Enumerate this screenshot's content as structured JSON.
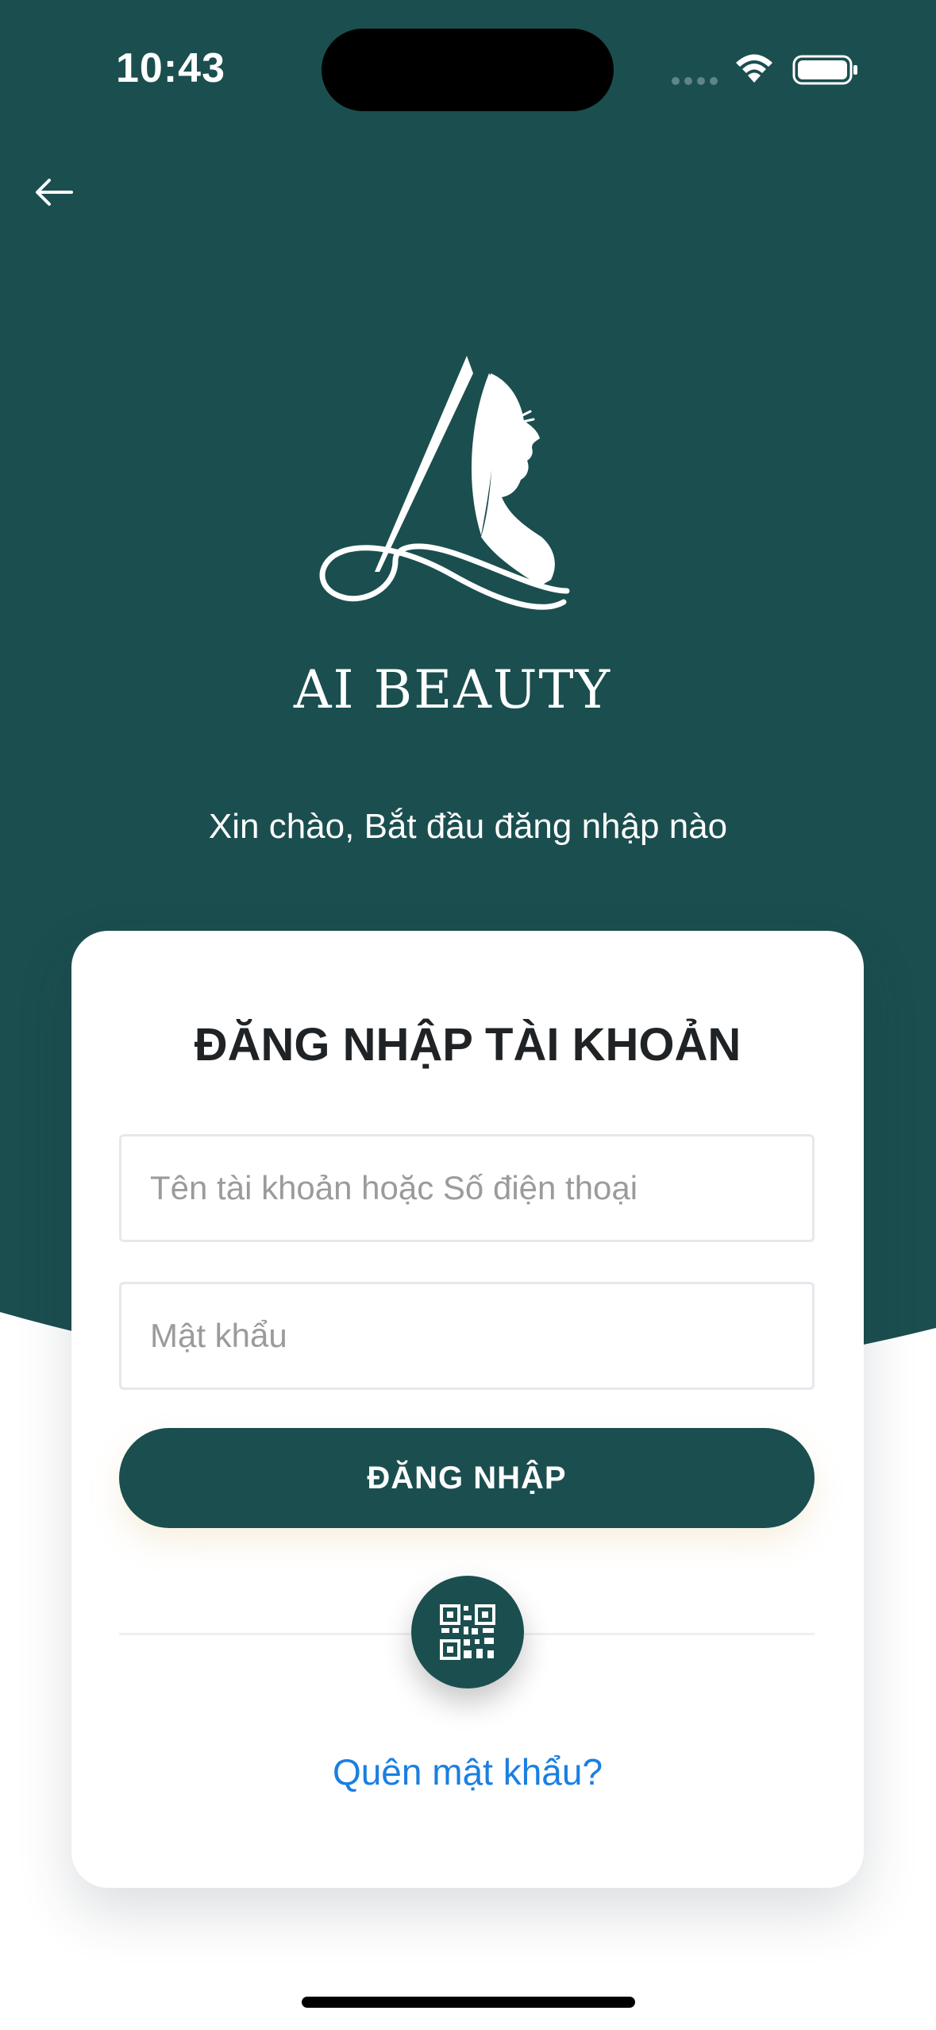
{
  "status_bar": {
    "time": "10:43"
  },
  "header": {
    "back_icon": "arrow-left-icon"
  },
  "brand": {
    "logo_icon": "woman-profile-logo",
    "name": "AI BEAUTY"
  },
  "greeting": "Xin chào, Bắt đầu đăng nhập nào",
  "login_card": {
    "title": "ĐĂNG NHẬP TÀI KHOẢN",
    "username": {
      "value": "",
      "placeholder": "Tên tài khoản hoặc Số điện thoại"
    },
    "password": {
      "value": "",
      "placeholder": "Mật khẩu"
    },
    "login_button_label": "ĐĂNG NHẬP",
    "qr_icon": "qr-code-icon",
    "forgot_password_label": "Quên mật khẩu?"
  },
  "colors": {
    "brand_teal": "#1b4e4f",
    "link_blue": "#1b7fe0",
    "card_bg": "#ffffff",
    "title_text": "#1f2326",
    "placeholder_text": "#9b9b9b"
  }
}
